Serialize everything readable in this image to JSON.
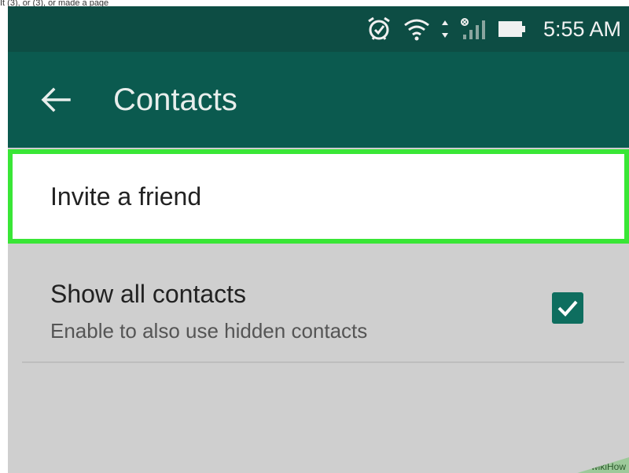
{
  "top_strip": {
    "text": "It (3), or (3), or made a page"
  },
  "status_bar": {
    "icons": [
      "alarm-icon",
      "wifi-icon",
      "data-arrows-icon",
      "signal-icon",
      "battery-icon"
    ],
    "time": "5:55 AM"
  },
  "app_bar": {
    "back_icon": "back-arrow-icon",
    "title": "Contacts"
  },
  "settings": {
    "invite": {
      "label": "Invite a friend"
    },
    "show_all_contacts": {
      "title": "Show all contacts",
      "subtitle": "Enable to also use hidden contacts",
      "checked": true
    }
  },
  "watermark": {
    "text": "wikiHow"
  },
  "colors": {
    "status_bar": "#0d4d44",
    "app_bar": "#0b5a4f",
    "highlight": "#39e636",
    "checkbox": "#0e6e5f",
    "background": "#cfcfcf"
  }
}
